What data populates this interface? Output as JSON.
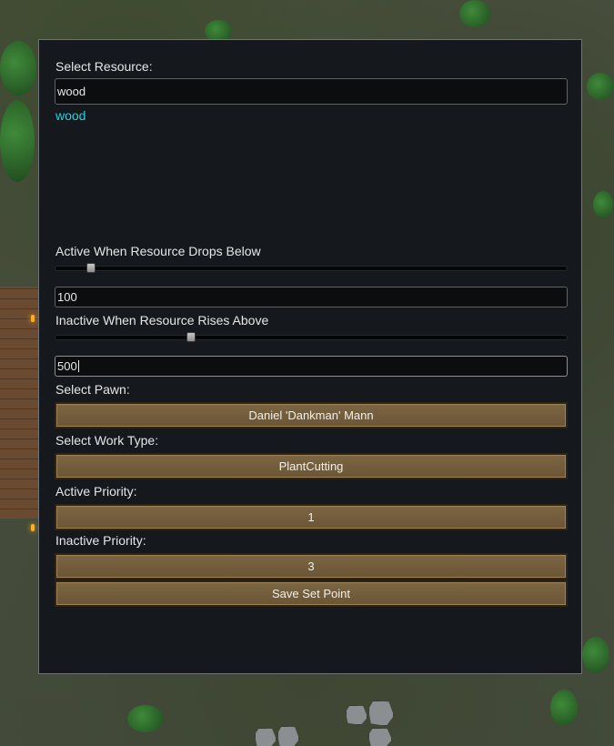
{
  "dialog": {
    "resource_label": "Select Resource:",
    "resource_value": "wood",
    "resource_suggestion": "wood",
    "active_label": "Active When Resource Drops Below",
    "active_value": "100",
    "inactive_label": "Inactive When Resource Rises Above",
    "inactive_value": "500",
    "pawn_label": "Select Pawn:",
    "pawn_button": "Daniel 'Dankman' Mann",
    "worktype_label": "Select Work Type:",
    "worktype_button": "PlantCutting",
    "active_priority_label": "Active Priority:",
    "active_priority_button": "1",
    "inactive_priority_label": "Inactive Priority:",
    "inactive_priority_button": "3",
    "save_button": "Save Set Point"
  },
  "sliders": {
    "active_fraction": 0.06,
    "inactive_fraction": 0.255
  },
  "colors": {
    "suggestion": "#22d3e0",
    "button": "#75603e",
    "panel": "#15191e"
  }
}
